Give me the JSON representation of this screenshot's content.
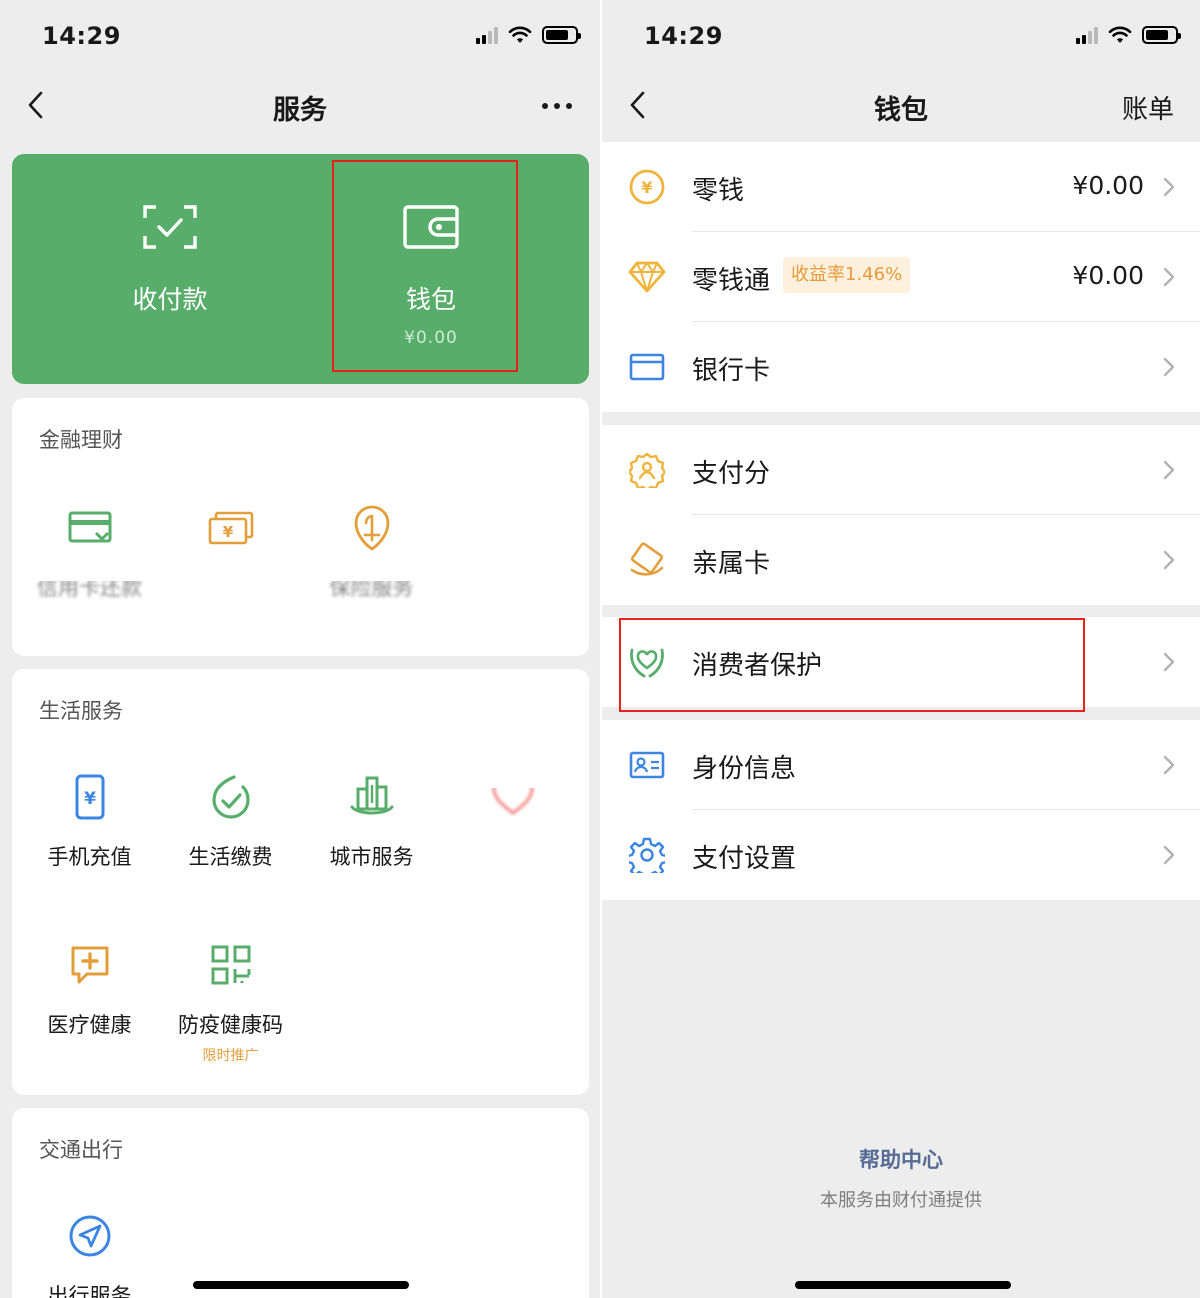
{
  "left": {
    "status": {
      "time": "14:29"
    },
    "nav": {
      "title": "服务",
      "more_icon": "more-icon"
    },
    "green_card": {
      "pay": {
        "label": "收付款",
        "icon": "scan-pay-icon"
      },
      "wallet": {
        "label": "钱包",
        "balance": "¥0.00",
        "icon": "wallet-icon"
      }
    },
    "finance": {
      "title": "金融理财",
      "items": [
        {
          "label": "信用卡还款",
          "icon": "credit-card-icon",
          "color": "#58ad6b"
        },
        {
          "label": "",
          "icon": "money-icon",
          "color": "#e39e3a"
        },
        {
          "label": "保险服务",
          "icon": "insurance-icon",
          "color": "#e39e3a"
        }
      ]
    },
    "life": {
      "title": "生活服务",
      "items": [
        {
          "label": "手机充值",
          "icon": "phone-recharge-icon",
          "color": "#3d85e3"
        },
        {
          "label": "生活缴费",
          "icon": "bill-pay-icon",
          "color": "#58ad6b"
        },
        {
          "label": "城市服务",
          "icon": "city-icon",
          "color": "#58ad6b"
        },
        {
          "label": "",
          "icon": "charity-icon",
          "color": "#e8211d"
        },
        {
          "label": "医疗健康",
          "icon": "medical-icon",
          "color": "#e39e3a"
        },
        {
          "label": "防疫健康码",
          "icon": "qr-code-icon",
          "color": "#58ad6b",
          "promo": "限时推广"
        }
      ]
    },
    "transport": {
      "title": "交通出行",
      "items": [
        {
          "label": "出行服务",
          "icon": "travel-icon",
          "color": "#3d85e3"
        }
      ]
    }
  },
  "right": {
    "status": {
      "time": "14:29"
    },
    "nav": {
      "title": "钱包",
      "action": "账单"
    },
    "group1": [
      {
        "label": "零钱",
        "value": "¥0.00",
        "icon": "coin-icon",
        "color": "#f0b43c"
      },
      {
        "label": "零钱通",
        "badge": "收益率1.46%",
        "value": "¥0.00",
        "icon": "diamond-icon",
        "color": "#f0b43c"
      },
      {
        "label": "银行卡",
        "icon": "bank-card-icon",
        "color": "#3d85e3"
      }
    ],
    "group2": [
      {
        "label": "支付分",
        "icon": "pay-score-icon",
        "color": "#f0b43c"
      },
      {
        "label": "亲属卡",
        "icon": "family-card-icon",
        "color": "#e39e3a"
      }
    ],
    "group3": [
      {
        "label": "消费者保护",
        "icon": "consumer-protection-icon",
        "color": "#58ad6b"
      }
    ],
    "group4": [
      {
        "label": "身份信息",
        "icon": "id-card-icon",
        "color": "#3d85e3"
      },
      {
        "label": "支付设置",
        "icon": "settings-gear-icon",
        "color": "#3d85e3"
      }
    ],
    "footer": {
      "link": "帮助中心",
      "note": "本服务由财付通提供"
    }
  }
}
